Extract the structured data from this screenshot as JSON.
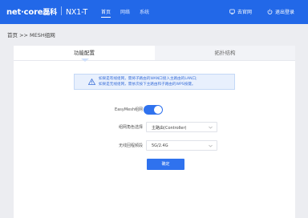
{
  "header": {
    "brand": "net·core",
    "brand_cn": "磊科",
    "model": "NX1-T",
    "nav": [
      "首页",
      "网络",
      "系统"
    ],
    "official_site": "去官网",
    "logout": "退出登录",
    "background_color": "#2268e8"
  },
  "breadcrumb": "首页 >> MESH组网",
  "tabs": {
    "active": "功能配置",
    "other": "拓扑结构"
  },
  "notice": {
    "line1": "如果是有线组网，需将子路由的WAN口接入主路由的LAN口;",
    "line2": "如果是无线组网，需依次按下主路由和子路由的WPS按键。"
  },
  "form": {
    "easymesh_label": "EasyMesh组网",
    "easymesh_enabled": true,
    "role_label": "组网角色选择",
    "role_value": "主路由(Controller)",
    "band_label": "无线回程频段",
    "band_value": "5G/2.4G",
    "confirm_label": "确定"
  },
  "colors": {
    "accent": "#2f72ee",
    "notice_text": "#3a6fd8"
  }
}
